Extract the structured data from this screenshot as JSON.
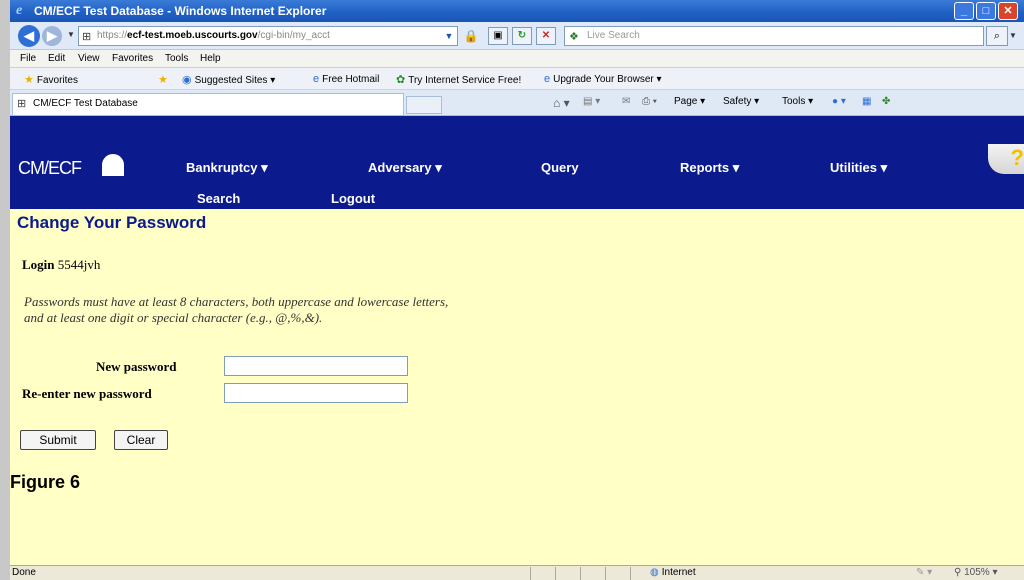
{
  "window": {
    "title": "CM/ECF Test Database - Windows Internet Explorer",
    "buttons": {
      "minimize": "_",
      "maximize": "□",
      "close": "✕"
    }
  },
  "address_bar": {
    "url_prefix": "https://",
    "url_host": "ecf-test.moeb.uscourts.gov",
    "url_rest": "/cgi-bin/my_acct",
    "search_placeholder": "Live Search"
  },
  "menu": {
    "items": [
      "File",
      "Edit",
      "View",
      "Favorites",
      "Tools",
      "Help"
    ]
  },
  "favorites_bar": {
    "favorites_label": "Favorites",
    "suggested_sites": "Suggested Sites ▾",
    "free_hotmail": "Free Hotmail",
    "try_isp": "Try Internet Service Free!",
    "upgrade_browser": "Upgrade Your Browser ▾"
  },
  "tab": {
    "title": "CM/ECF Test Database"
  },
  "command_bar": {
    "page": "Page ▾",
    "safety": "Safety ▾",
    "tools": "Tools ▾"
  },
  "ecf_nav": {
    "logo": "CM/ECF",
    "items": {
      "bankruptcy": "Bankruptcy ▾",
      "adversary": "Adversary ▾",
      "query": "Query",
      "reports": "Reports ▾",
      "utilities": "Utilities ▾",
      "search": "Search",
      "logout": "Logout"
    },
    "help_glyph": "?"
  },
  "page": {
    "title": "Change Your Password",
    "login_label": "Login",
    "login_value": "5544jvh",
    "rules_line1": "Passwords must have at least 8 characters, both uppercase and lowercase letters,",
    "rules_line2": "and at least one digit or special character (e.g., @,%,&).",
    "new_password_label": "New password",
    "reenter_password_label": "Re-enter new password",
    "new_password_value": "",
    "reenter_password_value": "",
    "submit_label": "Submit",
    "clear_label": "Clear",
    "figure_caption": "Figure 6"
  },
  "status_bar": {
    "status": "Done",
    "zone": "Internet",
    "zoom": "105%"
  }
}
